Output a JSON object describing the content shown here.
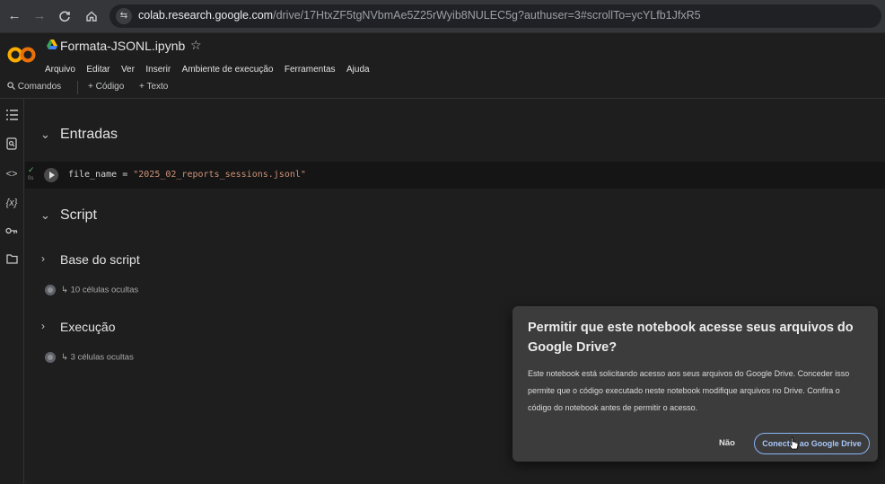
{
  "browser": {
    "url_host": "colab.research.google.com",
    "url_path": "/drive/17HtxZF5tgNVbmAe5Z25rWyib8NULEC5g?authuser=3#scrollTo=ycYLfb1JfxR5",
    "icons": [
      "back-arrow-icon",
      "forward-arrow-icon",
      "reload-icon",
      "home-icon",
      "site-settings-icon"
    ]
  },
  "header": {
    "notebook_title": "Formata-JSONL.ipynb",
    "menu": [
      "Arquivo",
      "Editar",
      "Ver",
      "Inserir",
      "Ambiente de execução",
      "Ferramentas",
      "Ajuda"
    ]
  },
  "toolbar": {
    "commands_label": "Comandos",
    "code_label": "+ Código",
    "text_label": "+ Texto"
  },
  "notebook": {
    "sections": [
      {
        "title": "Entradas",
        "expanded": true
      },
      {
        "title": "Script",
        "expanded": true
      },
      {
        "title": "Base do script",
        "expanded": false,
        "hidden_cells": "10 células ocultas"
      },
      {
        "title": "Execução",
        "expanded": false,
        "hidden_cells": "3 células ocultas"
      }
    ],
    "code_cell": {
      "variable": "file_name",
      "operator": " = ",
      "string_value": "\"2025_02_reports_sessions.jsonl\"",
      "status_label": "0s"
    }
  },
  "dialog": {
    "title": "Permitir que este notebook acesse seus arquivos do Google Drive?",
    "body": "Este notebook está solicitando acesso aos seus arquivos do Google Drive. Conceder isso permite que o código executado neste notebook modifique arquivos no Drive. Confira o código do notebook antes de permitir o acesso.",
    "cancel_label": "Não",
    "confirm_label": "Conectar ao Google Drive"
  },
  "colors": {
    "background": "#1e1e1e",
    "dialog": "#3c3c3c",
    "accent": "#8ab4f8",
    "colab_orange": "#f9ab00"
  }
}
